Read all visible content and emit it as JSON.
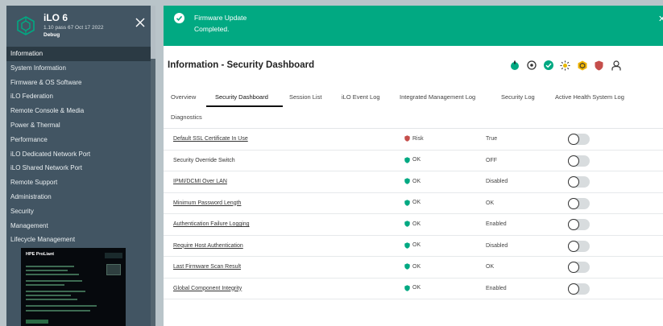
{
  "app": {
    "title": "iLO 6",
    "version": "1.10 pass 67 Oct 17 2022",
    "build": "Debug"
  },
  "sidebar": {
    "items": [
      {
        "label": "Information",
        "active": true
      },
      {
        "label": "System Information"
      },
      {
        "label": "Firmware & OS Software"
      },
      {
        "label": "iLO Federation"
      },
      {
        "label": "Remote Console & Media"
      },
      {
        "label": "Power & Thermal"
      },
      {
        "label": "Performance"
      },
      {
        "label": "iLO Dedicated Network Port"
      },
      {
        "label": "iLO Shared Network Port"
      },
      {
        "label": "Remote Support"
      },
      {
        "label": "Administration"
      },
      {
        "label": "Security"
      },
      {
        "label": "Management"
      },
      {
        "label": "Lifecycle Management"
      }
    ],
    "preview_title": "HPE ProLiant"
  },
  "notification": {
    "title": "Firmware Update",
    "message": "Completed.",
    "color": "#01a982"
  },
  "page": {
    "title": "Information - Security Dashboard"
  },
  "header_icons": [
    "power-status-icon",
    "uid-indicator-icon",
    "health-ok-icon",
    "sun-icon",
    "hex-badge-icon",
    "security-shield-icon",
    "user-icon"
  ],
  "tabs": [
    {
      "label": "Overview"
    },
    {
      "label": "Security Dashboard",
      "active": true
    },
    {
      "label": "Session List"
    },
    {
      "label": "iLO Event Log"
    },
    {
      "label": "Integrated Management Log"
    },
    {
      "label": "Security Log"
    },
    {
      "label": "Active Health System Log"
    },
    {
      "label": "Diagnostics"
    }
  ],
  "table": {
    "rows": [
      {
        "name": "Default SSL Certificate In Use",
        "link": true,
        "status": "Risk",
        "value": "True"
      },
      {
        "name": "Security Override Switch",
        "link": false,
        "status": "OK",
        "value": "OFF"
      },
      {
        "name": "IPMI/DCMI Over LAN",
        "link": true,
        "status": "OK",
        "value": "Disabled"
      },
      {
        "name": "Minimum Password Length",
        "link": true,
        "status": "OK",
        "value": "OK"
      },
      {
        "name": "Authentication Failure Logging",
        "link": true,
        "status": "OK",
        "value": "Enabled"
      },
      {
        "name": "Require Host Authentication",
        "link": true,
        "status": "OK",
        "value": "Disabled"
      },
      {
        "name": "Last Firmware Scan Result",
        "link": true,
        "status": "OK",
        "value": "OK"
      },
      {
        "name": "Global Component Integrity",
        "link": true,
        "status": "OK",
        "value": "Enabled"
      }
    ]
  },
  "colors": {
    "ok": "#01a982",
    "risk": "#c54e4b",
    "sidebar": "#425563"
  }
}
